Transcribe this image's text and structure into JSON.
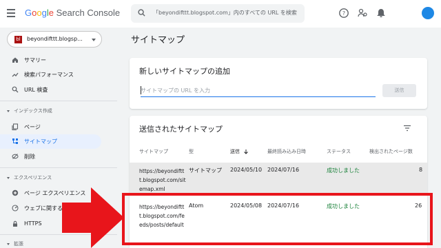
{
  "header": {
    "app_name": "Search Console",
    "brand": "Google",
    "search_placeholder": "「beyondifttt.blogspot.com」内のすべての URL を検索",
    "icons": [
      "menu-icon",
      "search-icon",
      "help-icon",
      "users-icon",
      "bell-icon",
      "avatar"
    ],
    "avatar_color": "#1e88e5"
  },
  "sidebar": {
    "property": "beyondifttt.blogsp...",
    "items": [
      {
        "label": "サマリー",
        "icon": "home-icon"
      },
      {
        "label": "検索パフォーマンス",
        "icon": "trend-icon"
      },
      {
        "label": "URL 検査",
        "icon": "search-icon"
      }
    ],
    "section_index": "インデックス作成",
    "index_items": [
      {
        "label": "ページ",
        "icon": "pages-icon"
      },
      {
        "label": "サイトマップ",
        "icon": "sitemap-icon",
        "active": true
      },
      {
        "label": "削除",
        "icon": "remove-icon"
      }
    ],
    "section_experience": "エクスペリエンス",
    "experience_items": [
      {
        "label": "ページ エクスペリエンス",
        "icon": "plus-circle-icon"
      },
      {
        "label": "ウェブに関する主な指標",
        "icon": "gauge-icon"
      },
      {
        "label": "HTTPS",
        "icon": "lock-icon"
      }
    ],
    "section_more": "拡張"
  },
  "main": {
    "page_title": "サイトマップ",
    "add_card": {
      "title": "新しいサイトマップの追加",
      "input_placeholder": "サイトマップの URL を入力",
      "submit_label": "送信"
    },
    "list_card": {
      "title": "送信されたサイトマップ",
      "columns": [
        "サイトマップ",
        "型",
        "送信",
        "最終読み込み日時",
        "ステータス",
        "検出されたページ数"
      ],
      "rows": [
        {
          "url": "https://beyondifttt.blogspot.com/sitemap.xml",
          "type": "サイトマップ",
          "submitted": "2024/05/10",
          "last_read": "2024/07/16",
          "status": "成功しました",
          "pages": "8"
        },
        {
          "url": "https://beyondifttt.blogspot.com/feeds/posts/default",
          "type": "Atom",
          "submitted": "2024/05/08",
          "last_read": "2024/07/16",
          "status": "成功しました",
          "pages": "26"
        }
      ]
    }
  },
  "colors": {
    "accent": "#1a73e8",
    "success": "#188038",
    "highlight": "#e8151b"
  }
}
